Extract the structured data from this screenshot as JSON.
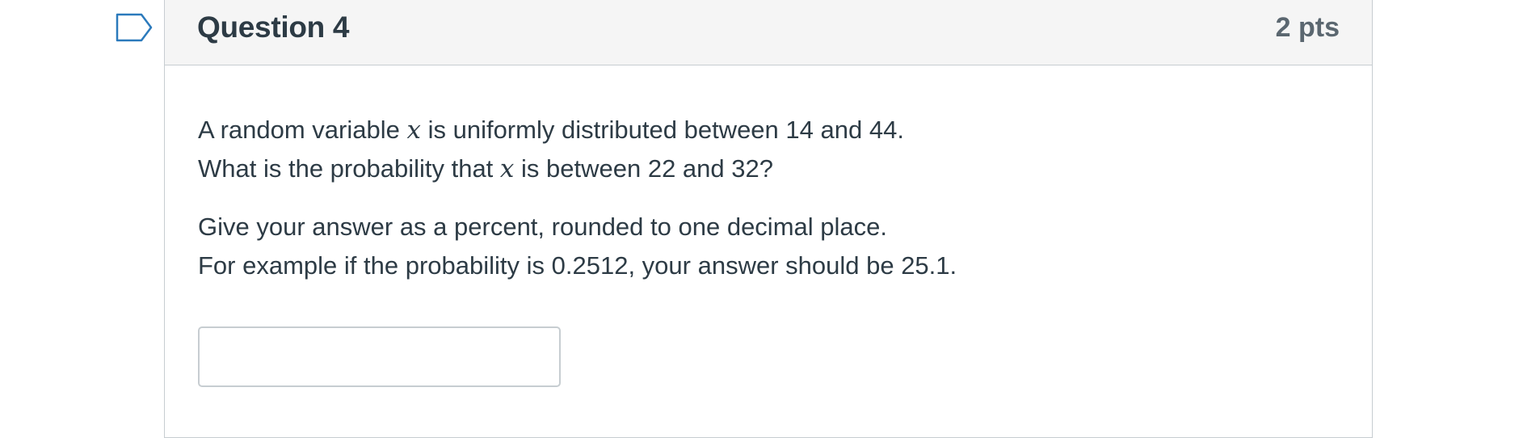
{
  "question": {
    "title": "Question 4",
    "points": "2 pts",
    "flag_icon": "bookmark-flag-icon",
    "line1_before": "A random variable ",
    "line1_var": "x",
    "line1_after": " is uniformly distributed between 14 and 44.",
    "line2_before": "What is the probability that ",
    "line2_var": "x",
    "line2_after": " is between 22 and 32?",
    "line3": "Give your answer as a percent, rounded to one decimal place.",
    "line4": "For example if the probability is 0.2512, your answer should be 25.1.",
    "answer_value": "",
    "answer_placeholder": ""
  },
  "colors": {
    "header_bg": "#f5f5f5",
    "border": "#c7cdd1",
    "text": "#2d3b45",
    "points_text": "#5b6770",
    "flag_stroke": "#2b7abc"
  }
}
